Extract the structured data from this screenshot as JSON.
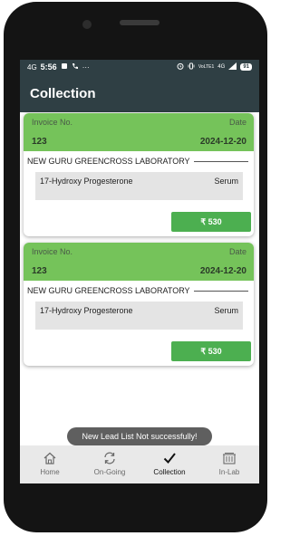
{
  "status_bar": {
    "network": "4G",
    "time": "5:56",
    "more": "···",
    "right_indicators": "VoLTE1",
    "right_net": "4G",
    "battery": "91"
  },
  "app_bar": {
    "title": "Collection"
  },
  "cards": [
    {
      "invoice_label": "Invoice No.",
      "date_label": "Date",
      "invoice_no": "123",
      "date": "2024-12-20",
      "lab_name": "NEW GURU GREENCROSS LABORATORY",
      "test_name": "17-Hydroxy Progesterone",
      "sample_type": "Serum",
      "amount": "₹ 530"
    },
    {
      "invoice_label": "Invoice No.",
      "date_label": "Date",
      "invoice_no": "123",
      "date": "2024-12-20",
      "lab_name": "NEW GURU GREENCROSS LABORATORY",
      "test_name": "17-Hydroxy Progesterone",
      "sample_type": "Serum",
      "amount": "₹ 530"
    }
  ],
  "toast": "New Lead List Not successfully!",
  "bottom_nav": [
    {
      "label": "Home",
      "icon": "home-icon"
    },
    {
      "label": "On-Going",
      "icon": "refresh-icon"
    },
    {
      "label": "Collection",
      "icon": "checkmark-icon",
      "active": true
    },
    {
      "label": "In-Lab",
      "icon": "building-icon"
    }
  ],
  "colors": {
    "app_bar": "#2f3f44",
    "card_header": "#75c35a",
    "amount_button": "#4caf50"
  }
}
